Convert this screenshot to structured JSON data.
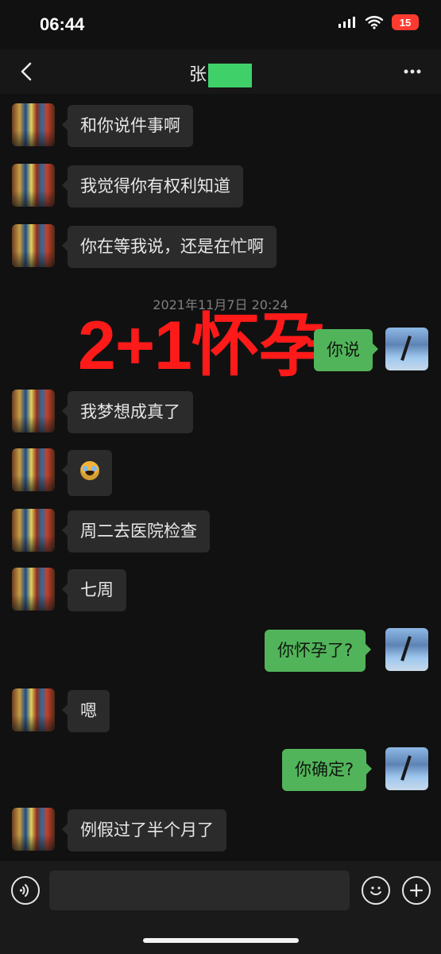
{
  "status": {
    "time": "06:44",
    "battery": "15"
  },
  "header": {
    "title": "张"
  },
  "chat": {
    "timestamp": "2021年11月7日 20:24",
    "overlay_text": "2+1怀孕",
    "messages": [
      {
        "side": "left",
        "text": "和你说件事啊"
      },
      {
        "side": "left",
        "text": "我觉得你有权利知道"
      },
      {
        "side": "left",
        "text": "你在等我说，还是在忙啊"
      },
      {
        "side": "right",
        "text": "你说"
      },
      {
        "side": "left",
        "text": "我梦想成真了"
      },
      {
        "side": "left",
        "text": ""
      },
      {
        "side": "left",
        "text": "周二去医院检查"
      },
      {
        "side": "left",
        "text": "七周"
      },
      {
        "side": "right",
        "text": "你怀孕了?"
      },
      {
        "side": "left",
        "text": "嗯"
      },
      {
        "side": "right",
        "text": "你确定?"
      },
      {
        "side": "left",
        "text": "例假过了半个月了"
      }
    ]
  },
  "colors": {
    "background": "#111111",
    "left_bubble": "#2b2b2b",
    "right_bubble": "#52b45a",
    "overlay": "#ff1a1a",
    "redaction": "#3fd06a"
  },
  "icons": {
    "back": "back-icon",
    "more": "more-icon",
    "voice": "voice-icon",
    "emoji": "emoji-icon",
    "plus": "plus-icon",
    "laugh_emoji": "laughing-tears-emoji-icon"
  }
}
